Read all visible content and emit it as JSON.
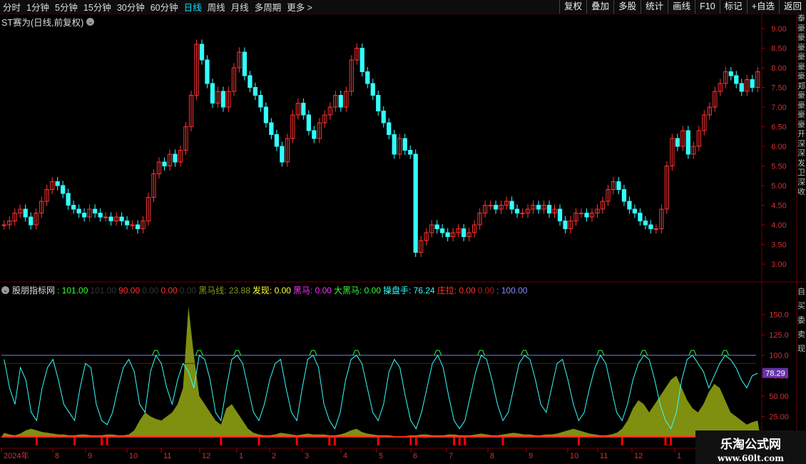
{
  "toolbar": {
    "periods": [
      "分时",
      "1分钟",
      "5分钟",
      "15分钟",
      "30分钟",
      "60分钟",
      "日线",
      "周线",
      "月线",
      "多周期",
      "更多 >"
    ],
    "active_index": 6,
    "right_buttons": [
      "复权",
      "叠加",
      "多股",
      "统计",
      "画线",
      "F10",
      "标记",
      "+自选",
      "返回"
    ]
  },
  "main_title": "ST赛为(日线,前复权)",
  "price_axis": [
    "9.00",
    "8.50",
    "8.00",
    "7.50",
    "7.00",
    "6.50",
    "6.00",
    "5.50",
    "5.00",
    "4.50",
    "4.00",
    "3.50",
    "3.00"
  ],
  "indicator": {
    "name": "股朋指标网",
    "items": [
      {
        "text": ": 101.00",
        "color": "#33ff33"
      },
      {
        "text": "101.00",
        "color": "#333333"
      },
      {
        "text": "90.00",
        "color": "#ff3333"
      },
      {
        "text": "0.00",
        "color": "#333333"
      },
      {
        "text": "0.00",
        "color": "#ff3333"
      },
      {
        "text": "0.00",
        "color": "#333333"
      },
      {
        "text": "黑马线: 23.88",
        "color": "#8a9a1a"
      },
      {
        "text": "发现: 0.00",
        "color": "#ffff33"
      },
      {
        "text": "黑马: 0.00",
        "color": "#ff33ff"
      },
      {
        "text": "大黑马: 0.00",
        "color": "#33ff33"
      },
      {
        "text": "操盘手: 76.24",
        "color": "#33ffff"
      },
      {
        "text": "庄拉: 0.00",
        "color": "#ff3333"
      },
      {
        "text": "0.00",
        "color": "#aa2222"
      },
      {
        "text": ": 100.00",
        "color": "#8888ff"
      }
    ]
  },
  "indicator_axis": [
    "150.0",
    "125.0",
    "100.0",
    "75.00",
    "50.00",
    "25.00"
  ],
  "current_value_tag": "78.29",
  "date_axis": [
    "2024年",
    "8",
    "9",
    "10",
    "11",
    "12",
    "1",
    "2",
    "3",
    "4",
    "5",
    "6",
    "7",
    "8",
    "9",
    "10",
    "11",
    "12",
    "1"
  ],
  "side_labels_top": "泰豪豪豪豪豪豪郑豪豪豪豪开深深发卫深收",
  "side_labels_bottom": "自买委卖现",
  "watermark": {
    "line1": "乐淘公式网",
    "line2": "www.60lt.com"
  },
  "colors": {
    "up": "#ff3333",
    "down": "#33ffff",
    "hline": "#7777ff",
    "volume": "#7f8f10",
    "signal": "#ff0000"
  },
  "chart_data": {
    "type": "candlestick",
    "price_range": [
      2.8,
      9.3
    ],
    "close_series": [
      4.0,
      4.1,
      4.3,
      4.4,
      4.2,
      4.0,
      4.3,
      4.6,
      4.9,
      5.1,
      5.0,
      4.8,
      4.5,
      4.4,
      4.3,
      4.2,
      4.4,
      4.3,
      4.2,
      4.2,
      4.1,
      4.2,
      4.1,
      4.0,
      4.0,
      3.9,
      4.1,
      4.7,
      5.3,
      5.6,
      5.5,
      5.8,
      5.6,
      5.9,
      6.5,
      7.3,
      8.6,
      8.2,
      7.6,
      7.1,
      7.4,
      7.0,
      7.4,
      8.0,
      8.4,
      7.8,
      7.5,
      7.3,
      7.0,
      6.6,
      6.3,
      6.0,
      5.6,
      6.2,
      6.8,
      7.1,
      6.8,
      6.4,
      6.2,
      6.6,
      6.8,
      7.0,
      7.3,
      7.0,
      7.4,
      8.2,
      8.5,
      7.9,
      7.6,
      7.3,
      6.9,
      6.6,
      6.3,
      5.8,
      6.2,
      5.9,
      5.8,
      3.3,
      3.6,
      3.8,
      4.0,
      3.9,
      3.8,
      3.7,
      3.8,
      3.9,
      3.7,
      3.8,
      4.0,
      4.3,
      4.5,
      4.5,
      4.4,
      4.5,
      4.6,
      4.4,
      4.3,
      4.3,
      4.4,
      4.5,
      4.4,
      4.5,
      4.3,
      4.4,
      4.1,
      3.9,
      4.1,
      4.3,
      4.3,
      4.2,
      4.3,
      4.4,
      4.6,
      4.9,
      5.1,
      4.9,
      4.6,
      4.4,
      4.3,
      4.1,
      4.0,
      3.9,
      3.9,
      4.4,
      5.5,
      6.2,
      6.0,
      6.4,
      5.8,
      6.0,
      6.4,
      6.8,
      7.0,
      7.4,
      7.6,
      7.9,
      7.8,
      7.6,
      7.4,
      7.7,
      7.5,
      7.9
    ],
    "indicator_range": [
      0,
      175
    ],
    "oscillator": [
      95,
      60,
      40,
      85,
      70,
      30,
      20,
      60,
      85,
      95,
      70,
      40,
      30,
      20,
      60,
      90,
      85,
      40,
      20,
      15,
      30,
      60,
      85,
      95,
      80,
      40,
      30,
      80,
      100,
      90,
      60,
      40,
      70,
      90,
      80,
      60,
      100,
      95,
      70,
      30,
      20,
      60,
      95,
      100,
      90,
      60,
      30,
      20,
      40,
      70,
      90,
      95,
      60,
      30,
      20,
      60,
      95,
      100,
      85,
      40,
      20,
      10,
      30,
      70,
      95,
      100,
      90,
      60,
      30,
      20,
      40,
      80,
      95,
      85,
      50,
      20,
      10,
      30,
      60,
      90,
      100,
      85,
      50,
      20,
      10,
      20,
      50,
      80,
      100,
      95,
      70,
      40,
      20,
      30,
      60,
      90,
      100,
      95,
      70,
      40,
      30,
      60,
      90,
      95,
      70,
      40,
      20,
      30,
      60,
      85,
      100,
      90,
      60,
      30,
      20,
      40,
      70,
      90,
      100,
      95,
      70,
      40,
      20,
      10,
      30,
      70,
      95,
      100,
      90,
      80,
      60,
      75,
      90,
      100,
      95,
      85,
      70,
      60,
      75,
      78
    ],
    "volume_area": [
      5,
      3,
      2,
      4,
      8,
      10,
      8,
      6,
      5,
      4,
      3,
      3,
      2,
      2,
      3,
      3,
      2,
      2,
      2,
      3,
      3,
      2,
      2,
      3,
      8,
      20,
      30,
      25,
      22,
      20,
      25,
      30,
      40,
      60,
      160,
      100,
      50,
      40,
      30,
      20,
      15,
      35,
      40,
      30,
      20,
      10,
      5,
      3,
      2,
      2,
      3,
      5,
      4,
      3,
      2,
      3,
      4,
      3,
      3,
      3,
      2,
      2,
      3,
      5,
      8,
      10,
      6,
      4,
      3,
      2,
      2,
      2,
      1,
      1,
      1,
      2,
      2,
      3,
      3,
      2,
      2,
      2,
      3,
      3,
      2,
      2,
      2,
      3,
      4,
      3,
      2,
      2,
      3,
      4,
      5,
      4,
      3,
      3,
      2,
      2,
      3,
      3,
      4,
      6,
      8,
      10,
      8,
      6,
      4,
      3,
      2,
      2,
      3,
      5,
      10,
      20,
      35,
      45,
      40,
      30,
      40,
      50,
      60,
      70,
      75,
      60,
      45,
      35,
      30,
      40,
      55,
      65,
      60,
      45,
      30,
      25,
      20,
      15,
      18,
      20
    ]
  }
}
